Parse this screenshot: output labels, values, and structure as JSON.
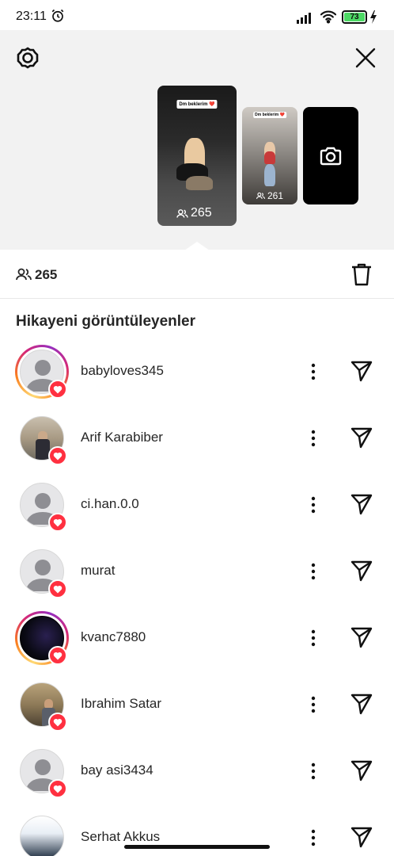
{
  "status_bar": {
    "time": "23:11",
    "battery_level": "73",
    "icons": [
      "alarm-icon",
      "signal-icon",
      "wifi-icon",
      "battery-icon",
      "charging-icon"
    ]
  },
  "header": {
    "icons": [
      "settings-icon",
      "close-icon"
    ],
    "stories": [
      {
        "caption": "Dm beklerim ❤️",
        "views": "265"
      },
      {
        "caption": "Dm beklerim ❤️",
        "views": "261"
      }
    ],
    "camera_icon": "camera-icon"
  },
  "summary": {
    "viewer_count": "265",
    "icons": [
      "viewers-icon",
      "trash-icon"
    ]
  },
  "section_title": "Hikayeni görüntüleyenler",
  "viewers": [
    {
      "username": "babyloves345"
    },
    {
      "username": "Arif Karabiber"
    },
    {
      "username": "ci.han.0.0"
    },
    {
      "username": "murat"
    },
    {
      "username": "kvanc7880"
    },
    {
      "username": "Ibrahim Satar"
    },
    {
      "username": "bay asi3434"
    },
    {
      "username": "Serhat Akkus"
    }
  ],
  "colors": {
    "like_badge": "#ff3040",
    "battery_fill": "#4cd964",
    "header_bg": "#f2f2f2"
  }
}
